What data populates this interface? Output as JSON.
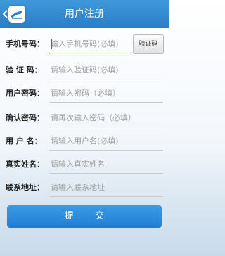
{
  "header": {
    "title": "用户注册",
    "back_icon": "chevron-left-icon",
    "logo_icon": "app-logo-icon"
  },
  "form": {
    "fields": [
      {
        "label": "手机号码：",
        "placeholder": "输入手机号码(必填)"
      },
      {
        "label": "验 证 码：",
        "placeholder": "请输入验证码(必填)"
      },
      {
        "label": "用户密码：",
        "placeholder": "请输入密码（必填）"
      },
      {
        "label": "确认密码：",
        "placeholder": "请再次输入密码（必填）"
      },
      {
        "label": "用 户 名：",
        "placeholder": "请输入用户名(必填)"
      },
      {
        "label": "真实姓名：",
        "placeholder": "请输入真实姓名"
      },
      {
        "label": "联系地址：",
        "placeholder": "请输入联系地址"
      }
    ],
    "verify_button": "验证码",
    "submit_label": "提交"
  },
  "colors": {
    "header": "#2a7dc6",
    "button": "#1f7ed4",
    "active_underline": "#c44f4f"
  }
}
